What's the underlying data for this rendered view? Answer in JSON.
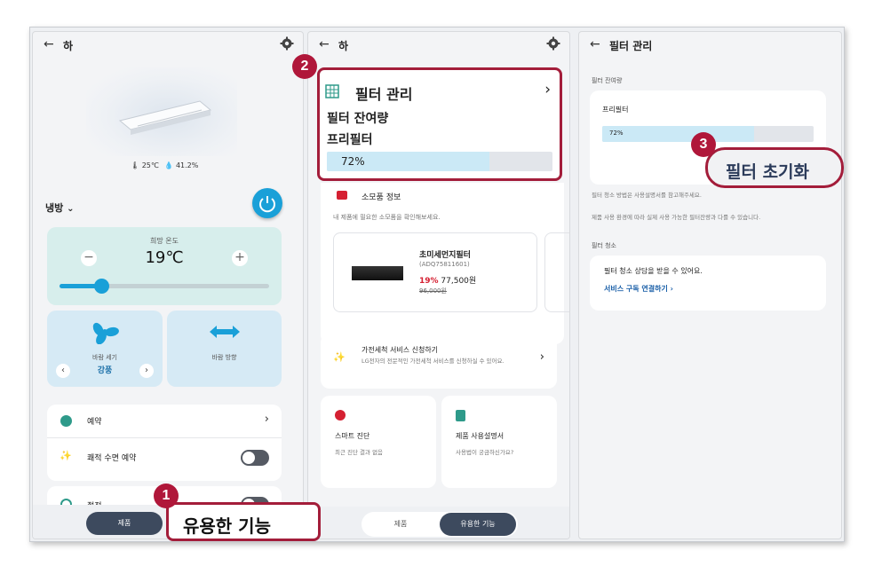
{
  "panel1": {
    "title": "하",
    "sensor_temp": "25℃",
    "sensor_humidity": "41.2%",
    "mode_label": "냉방",
    "desired_temp_label": "희망 온도",
    "desired_temp_value": "19℃",
    "slider_level": 0.2,
    "fan_speed_label": "바람 세기",
    "fan_speed_value": "강풍",
    "wind_direction_label": "바람 방향",
    "menu": [
      {
        "label": "예약"
      },
      {
        "label": "쾌적 수면 예약"
      },
      {
        "label": "절전"
      }
    ],
    "bottom_tab_label": "제품"
  },
  "panel2": {
    "title": "하",
    "filter_header": "필터 관리",
    "filter_remaining_label": "필터 잔여량",
    "prefilter_label": "프리필터",
    "filter_percent_text": "72%",
    "filter_level": 0.72,
    "consumables_title": "소모품 정보",
    "consumables_desc": "내 제품에 필요한 소모품을 확인해보세요.",
    "product_name": "초미세먼지필터",
    "product_code": "(ADQ75811601)",
    "discount": "19%",
    "price": "77,500원",
    "original_price": "96,000원",
    "service_title": "가전세척 서비스 신청하기",
    "service_desc": "LG전자의 전문적인 가전세척 서비스를 신청하실 수 있어요.",
    "diag_title": "스마트 진단",
    "diag_desc": "최근 진단 결과 없음",
    "manual_title": "제품 사용설명서",
    "manual_desc": "사용법이 궁금하신가요?",
    "tab_product": "제품",
    "tab_useful": "유용한 기능"
  },
  "panel3": {
    "title": "필터 관리",
    "remaining_section": "필터 잔여량",
    "prefilter_label": "프리필터",
    "filter_percent_text": "72%",
    "filter_level": 0.72,
    "note1": "필터 청소 방법은 사용설명서를 참고해주세요.",
    "note2": "제품 사용 환경에 따라 실제 사용 가능한 필터잔량과 다를 수 있습니다.",
    "cleaning_section": "필터 청소",
    "cleaning_desc": "필터 청소 상담을 받을 수 있어요.",
    "cleaning_link": "서비스 구독 연결하기"
  },
  "callouts": [
    {
      "number": "1",
      "text": "유용한 기능"
    },
    {
      "number": "2",
      "text": ""
    },
    {
      "number": "3",
      "text": "필터 초기화"
    }
  ],
  "colors": {
    "accent_blue": "#1aa0d8",
    "callout_red": "#a31d3a",
    "card_mint": "#d7eeec",
    "card_lightblue": "#d6eaf5",
    "dark_pill": "#3d4a5e"
  }
}
